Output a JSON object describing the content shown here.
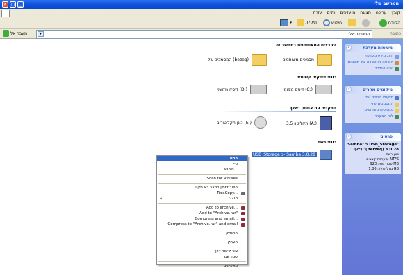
{
  "window": {
    "title": "המחשב שלי"
  },
  "menu": {
    "items": [
      "קובץ",
      "עריכה",
      "תצוגה",
      "מועדפים",
      "כלים",
      "עזרה"
    ]
  },
  "toolbar": {
    "back": "הקודם",
    "search": "חיפוש",
    "folders": "תיקיות"
  },
  "address": {
    "label": "כתובת",
    "value": "המחשב שלי",
    "go": "מעבר אל"
  },
  "sidebar": {
    "system_tasks": {
      "title": "משימות מערכת",
      "items": [
        "הצג מידע מערכת",
        "הוספה או הסרה של תוכניות",
        "שנה הגדרה"
      ]
    },
    "other_places": {
      "title": "מיקומים אחרים",
      "items": [
        "מיקומי הרשת שלי",
        "המסמכים שלי",
        "מסמכים משותפים",
        "לוח הבקרה"
      ]
    },
    "details": {
      "title": "פרטים",
      "name": "Samba\" ב USB_Storage\" (Z:) \"(Berzeq) 3.0.28",
      "lines": [
        "כונן רשת",
        "מערכת קבצים: NTFS",
        "שטח פנוי: 920 MB",
        "גודל כולל: 1.86 GB"
      ]
    }
  },
  "groups": {
    "files": "הקבצים המאוחסנים במחשב זה",
    "hdd": "כונני דיסקים קשיחים",
    "removable": "התקנים עם אחסון נשלף",
    "network": "כונני רשת"
  },
  "items": {
    "shared_docs": "מסמכים משותפים",
    "my_docs": "המסמכים של (bezeq)",
    "disk_c": "דיסק מקומי (C:)",
    "disk_d": "דיסק מקומי (D:)",
    "floppy": "תקליטון 3.5 (A:)",
    "cd": "כונן תקליטורים (E:)",
    "net_drive": "USB_Storage ב- Samba 3.0.28"
  },
  "context_menu": {
    "items": [
      "פתח",
      "סייר",
      "חיפוש...",
      "Scan for Viruses",
      "הפוך לזמין במצב לא מקוון",
      "TeraCopy...",
      "7-Zip",
      "Add to archive...",
      "Add to \"Archive.rar\"",
      "Compress and email...",
      "Compress to \"Archive.rar\" and email",
      "התנתק",
      "העתק",
      "צור קיצור דרך",
      "שנה שם",
      "מאפיינים"
    ]
  },
  "colors": {
    "accent": "#316ac5",
    "titlebar": "#0b4fd8",
    "sidebar": "#6f8fe0"
  }
}
